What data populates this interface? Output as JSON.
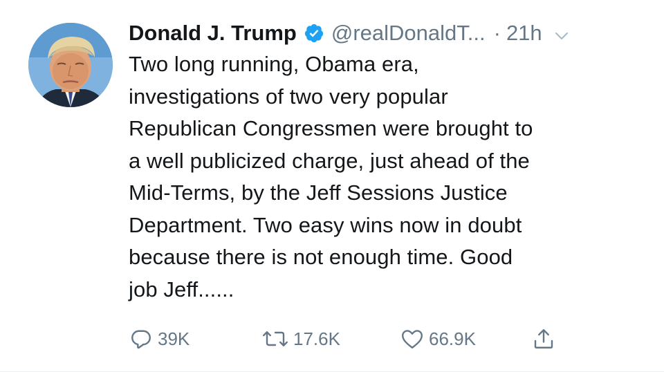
{
  "tweet": {
    "author_name": "Donald J. Trump",
    "handle": "@realDonaldT...",
    "separator": "·",
    "time": "21h",
    "text": "Two long running, Obama era,\ninvestigations of  two very popular\nRepublican Congressmen were brought to\na well publicized charge, just ahead of the\nMid-Terms, by the Jeff Sessions Justice\nDepartment. Two easy wins now in doubt\nbecause there is not enough time. Good\njob Jeff......",
    "replies": "39K",
    "retweets": "17.6K",
    "likes": "66.9K"
  },
  "icons": {
    "verified": "verified-badge-icon",
    "menu": "chevron-down-icon",
    "reply": "reply-icon",
    "retweet": "retweet-icon",
    "like": "heart-icon",
    "share": "share-icon"
  },
  "colors": {
    "text": "#14171a",
    "secondary": "#657786",
    "verified": "#1da1f2",
    "divider": "#e6ecf0"
  }
}
